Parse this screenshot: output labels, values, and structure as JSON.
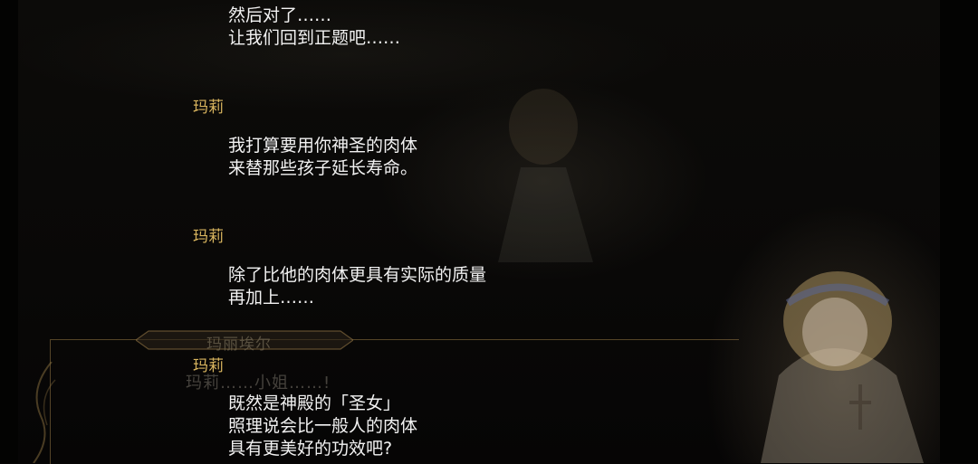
{
  "backlog": {
    "entry0": {
      "lines": [
        "然后对了……",
        "让我们回到正题吧……"
      ]
    },
    "entry1": {
      "speaker": "玛莉",
      "lines": [
        "我打算要用你神圣的肉体",
        "来替那些孩子延长寿命。"
      ]
    },
    "entry2": {
      "speaker": "玛莉",
      "lines": [
        "除了比他的肉体更具有实际的质量",
        "再加上……"
      ]
    },
    "entry3": {
      "speaker": "玛莉",
      "lines": [
        "既然是神殿的「圣女」",
        "照理说会比一般人的肉体",
        "具有更美好的功效吧?"
      ]
    }
  },
  "dialogue_box": {
    "speaker": "玛丽埃尔",
    "text": "玛莉……小姐……!"
  },
  "colors": {
    "speaker_name": "#d8b45e",
    "log_text": "#f2f2f2",
    "frame_gold": "#96784a"
  }
}
